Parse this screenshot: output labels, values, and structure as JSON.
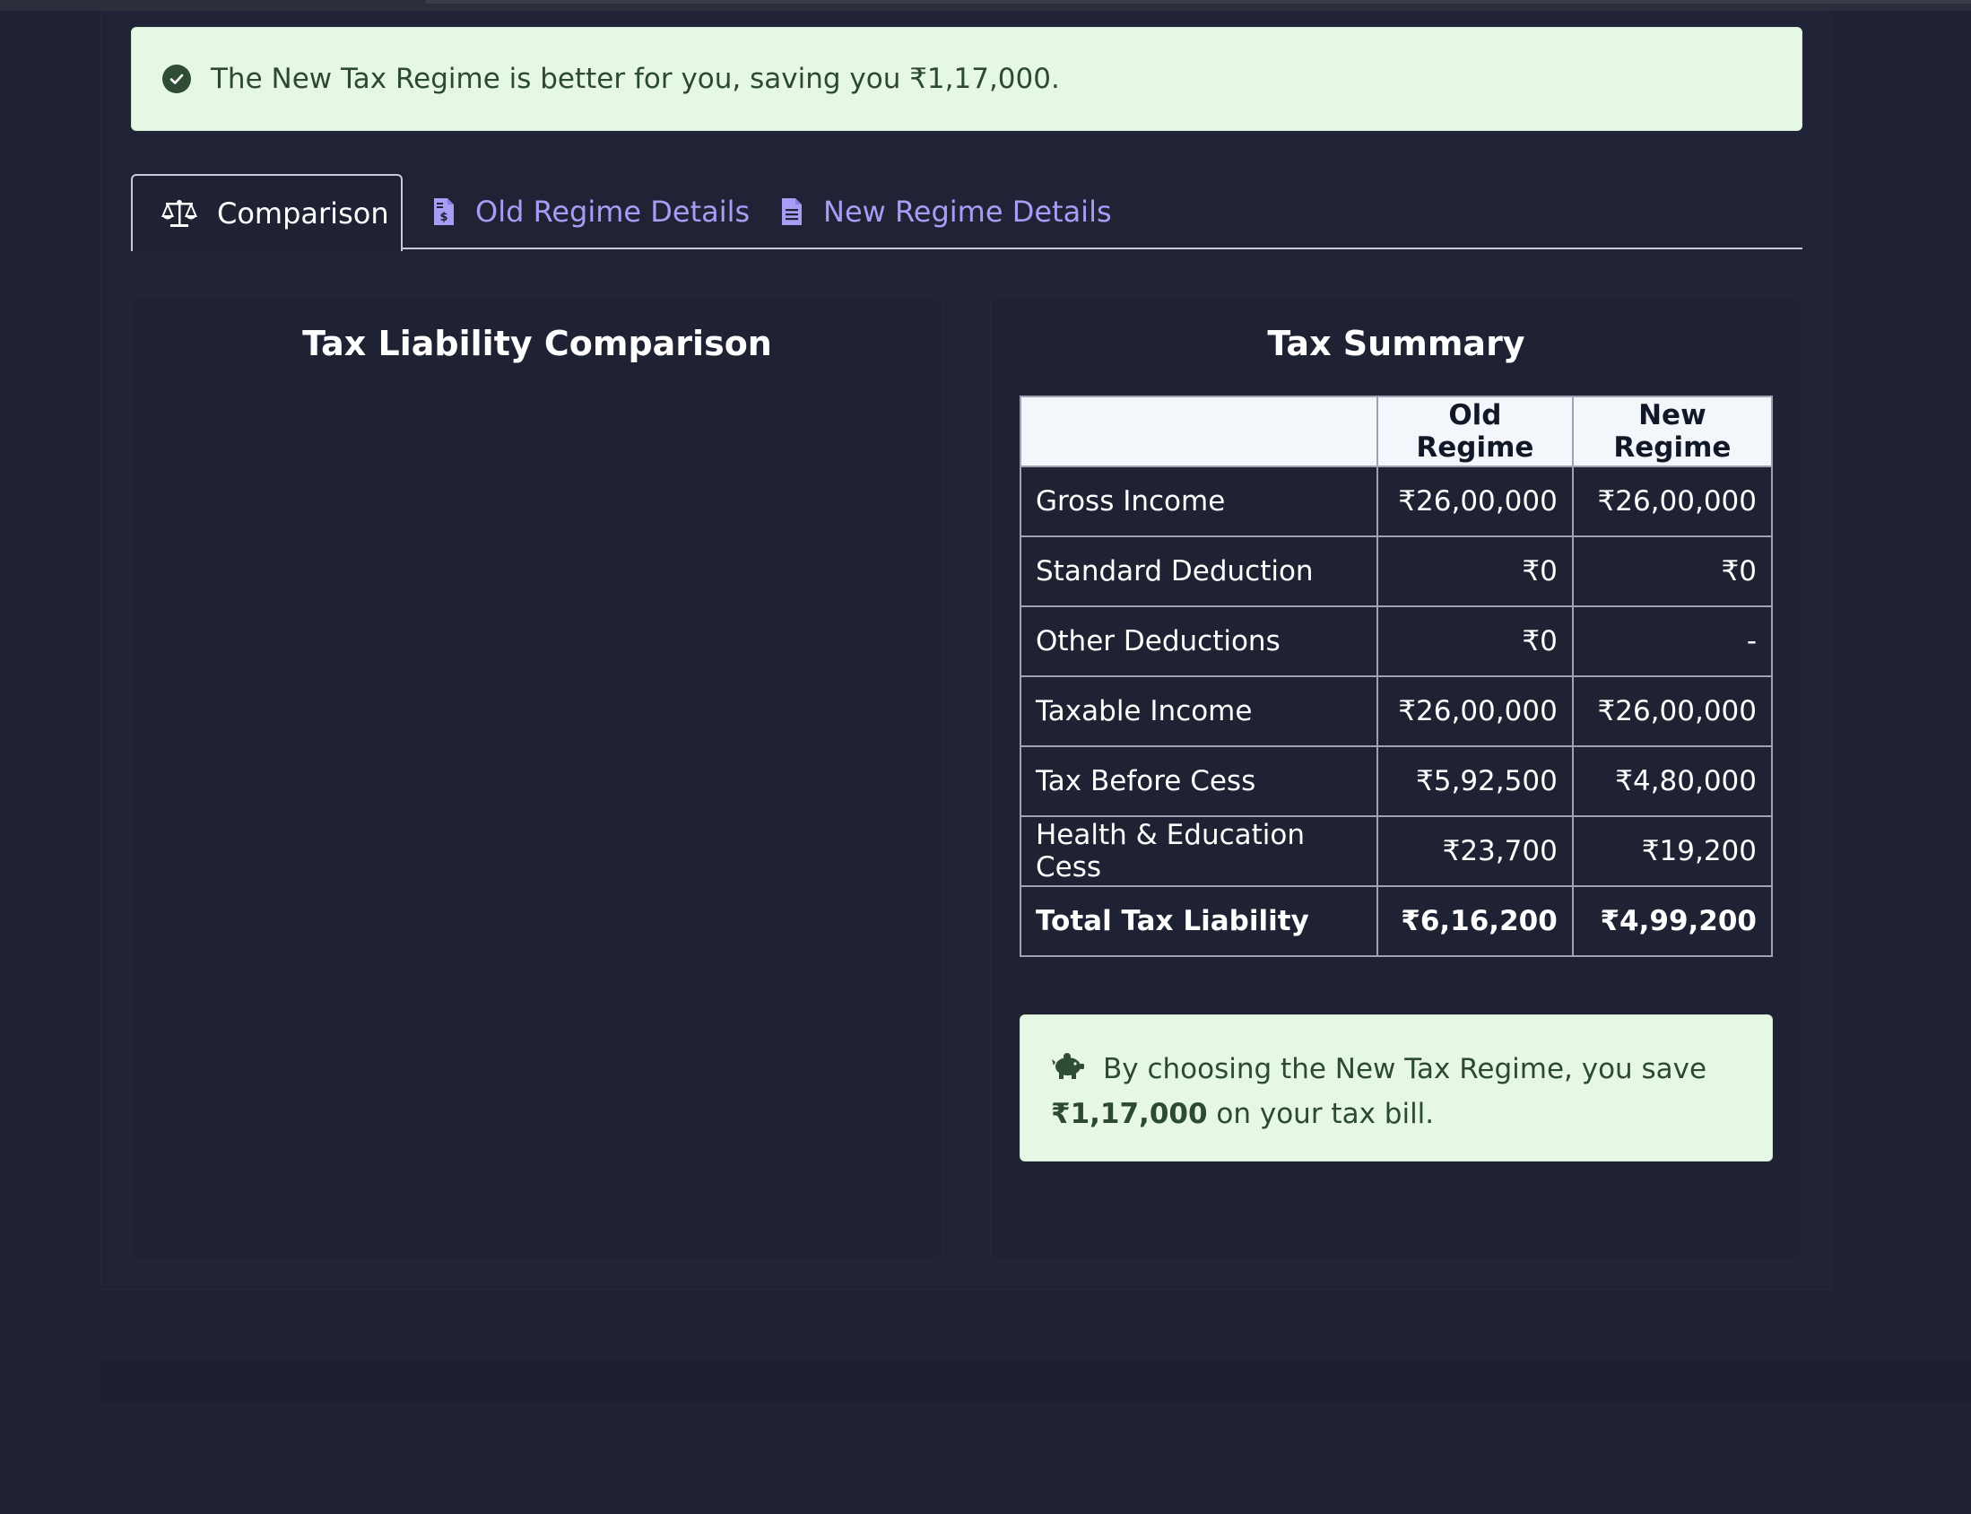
{
  "banner": {
    "message": "The New Tax Regime is better for you, saving you ₹1,17,000.",
    "icon": "check-circle-icon"
  },
  "tabs": [
    {
      "label": "Comparison",
      "icon": "balance-scale-icon",
      "active": true
    },
    {
      "label": "Old Regime Details",
      "icon": "file-invoice-dollar-icon",
      "active": false
    },
    {
      "label": "New Regime Details",
      "icon": "file-lines-icon",
      "active": false
    }
  ],
  "left_card": {
    "title": "Tax Liability Comparison"
  },
  "summary": {
    "title": "Tax Summary",
    "columns": [
      "",
      "Old Regime",
      "New Regime"
    ],
    "rows": [
      {
        "label": "Gross Income",
        "old": "₹26,00,000",
        "new": "₹26,00,000"
      },
      {
        "label": "Standard Deduction",
        "old": "₹0",
        "new": "₹0"
      },
      {
        "label": "Other Deductions",
        "old": "₹0",
        "new": "-"
      },
      {
        "label": "Taxable Income",
        "old": "₹26,00,000",
        "new": "₹26,00,000"
      },
      {
        "label": "Tax Before Cess",
        "old": "₹5,92,500",
        "new": "₹4,80,000"
      },
      {
        "label": "Health & Education Cess",
        "old": "₹23,700",
        "new": "₹19,200"
      },
      {
        "label": "Total Tax Liability",
        "old": "₹6,16,200",
        "new": "₹4,99,200"
      }
    ]
  },
  "savings_note": {
    "icon": "piggy-bank-icon",
    "prefix": "By choosing the New Tax Regime, you save",
    "amount": "₹1,17,000",
    "suffix": "on your tax bill."
  },
  "colors": {
    "background": "#1e2233",
    "success_bg": "#e6f7e6",
    "success_text": "#2c4a30",
    "tab_link": "#a99cf4",
    "table_header_bg": "#f3f7fb"
  }
}
